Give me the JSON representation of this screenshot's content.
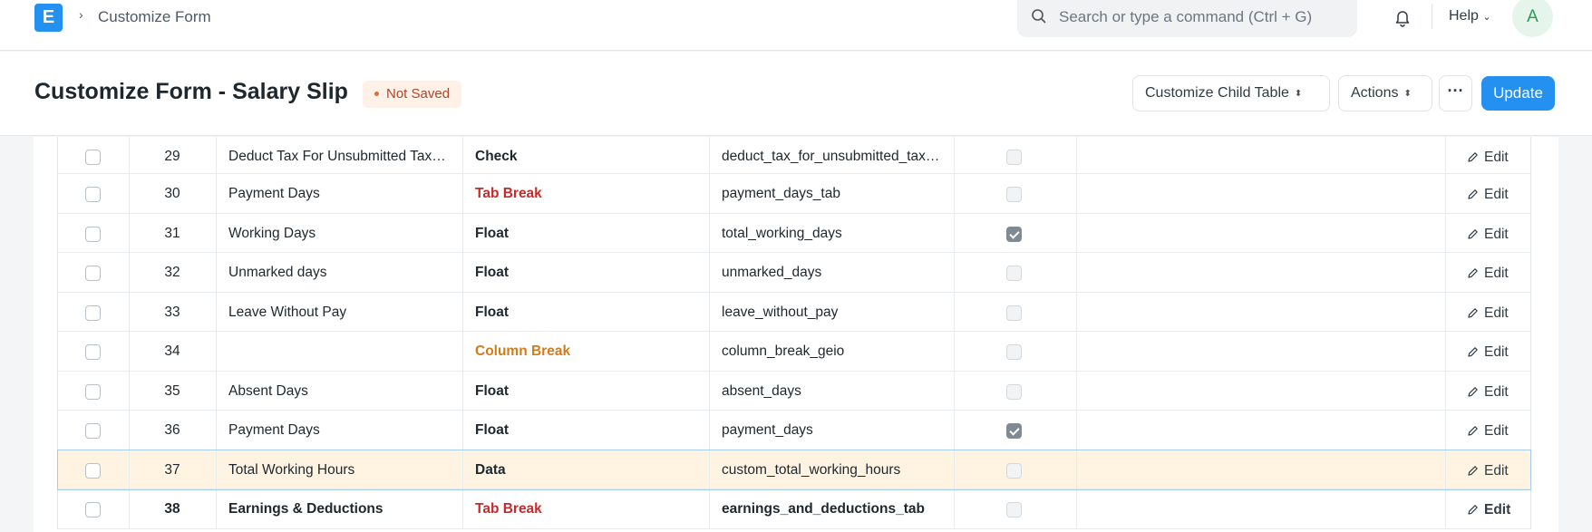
{
  "navbar": {
    "logo": "E",
    "breadcrumb": "Customize Form",
    "search_placeholder": "Search or type a command (Ctrl + G)",
    "help_label": "Help",
    "avatar_initial": "A"
  },
  "page": {
    "title": "Customize Form - Salary Slip",
    "status_badge": "Not Saved",
    "customize_child_table_label": "Customize Child Table",
    "actions_label": "Actions",
    "more_label": "···",
    "update_label": "Update"
  },
  "table": {
    "edit_label": "Edit",
    "rows": [
      {
        "idx": "29",
        "label": "Deduct Tax For Unsubmitted Tax…",
        "type": "Check",
        "type_color": "#1f272e",
        "fieldname": "deduct_tax_for_unsubmitted_tax…",
        "checked": false,
        "bold": false
      },
      {
        "idx": "30",
        "label": "Payment Days",
        "type": "Tab Break",
        "type_color": "#cb2929",
        "fieldname": "payment_days_tab",
        "checked": false,
        "bold": false
      },
      {
        "idx": "31",
        "label": "Working Days",
        "type": "Float",
        "type_color": "#1f272e",
        "fieldname": "total_working_days",
        "checked": true,
        "bold": false
      },
      {
        "idx": "32",
        "label": "Unmarked days",
        "type": "Float",
        "type_color": "#1f272e",
        "fieldname": "unmarked_days",
        "checked": false,
        "bold": false
      },
      {
        "idx": "33",
        "label": "Leave Without Pay",
        "type": "Float",
        "type_color": "#1f272e",
        "fieldname": "leave_without_pay",
        "checked": false,
        "bold": false
      },
      {
        "idx": "34",
        "label": "",
        "type": "Column Break",
        "type_color": "#d47b18",
        "fieldname": "column_break_geio",
        "checked": false,
        "bold": false
      },
      {
        "idx": "35",
        "label": "Absent Days",
        "type": "Float",
        "type_color": "#1f272e",
        "fieldname": "absent_days",
        "checked": false,
        "bold": false
      },
      {
        "idx": "36",
        "label": "Payment Days",
        "type": "Float",
        "type_color": "#1f272e",
        "fieldname": "payment_days",
        "checked": true,
        "bold": false
      },
      {
        "idx": "37",
        "label": "Total Working Hours",
        "type": "Data",
        "type_color": "#1f272e",
        "fieldname": "custom_total_working_hours",
        "checked": false,
        "bold": false,
        "highlight": true
      },
      {
        "idx": "38",
        "label": "Earnings & Deductions",
        "type": "Tab Break",
        "type_color": "#cb2929",
        "fieldname": "earnings_and_deductions_tab",
        "checked": false,
        "bold": true
      }
    ]
  }
}
